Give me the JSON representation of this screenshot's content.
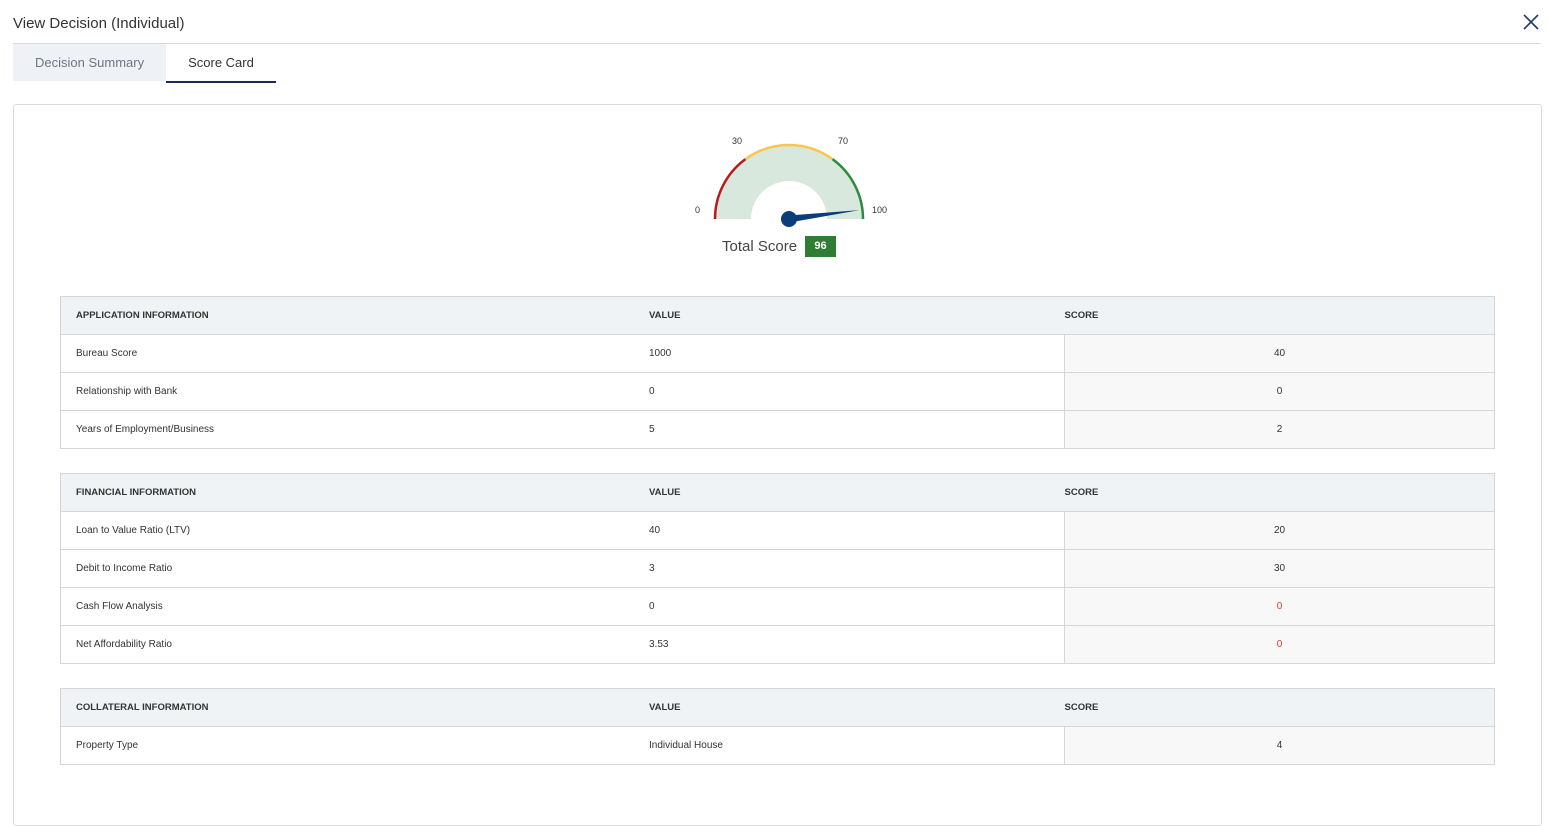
{
  "header": {
    "title": "View Decision (Individual)"
  },
  "tabs": [
    {
      "label": "Decision Summary",
      "active": false
    },
    {
      "label": "Score Card",
      "active": true
    }
  ],
  "gauge": {
    "min_label": "0",
    "label_30": "30",
    "label_70": "70",
    "max_label": "100",
    "value": 96,
    "colors": {
      "low": "#b71c1c",
      "mid": "#f9c74f",
      "high": "#2e8b3e",
      "fill": "#d8e8dc",
      "needle": "#0b3d7a"
    }
  },
  "total_score": {
    "label": "Total Score",
    "value": "96"
  },
  "tables": [
    {
      "section": "APPLICATION INFORMATION",
      "value_header": "VALUE",
      "score_header": "SCORE",
      "rows": [
        {
          "name": "Bureau Score",
          "value": "1000",
          "score": "40"
        },
        {
          "name": "Relationship with Bank",
          "value": "0",
          "score": "0"
        },
        {
          "name": "Years of Employment/Business",
          "value": "5",
          "score": "2"
        }
      ]
    },
    {
      "section": "FINANCIAL INFORMATION",
      "value_header": "VALUE",
      "score_header": "SCORE",
      "rows": [
        {
          "name": "Loan to Value Ratio (LTV)",
          "value": "40",
          "score": "20"
        },
        {
          "name": "Debit to Income Ratio",
          "value": "3",
          "score": "30"
        },
        {
          "name": "Cash Flow Analysis",
          "value": "0",
          "score": "0",
          "score_red": true
        },
        {
          "name": "Net Affordability Ratio",
          "value": "3.53",
          "score": "0",
          "score_red": true
        }
      ]
    },
    {
      "section": "COLLATERAL INFORMATION",
      "value_header": "VALUE",
      "score_header": "SCORE",
      "rows": [
        {
          "name": "Property Type",
          "value": "Individual House",
          "score": "4"
        }
      ]
    }
  ]
}
